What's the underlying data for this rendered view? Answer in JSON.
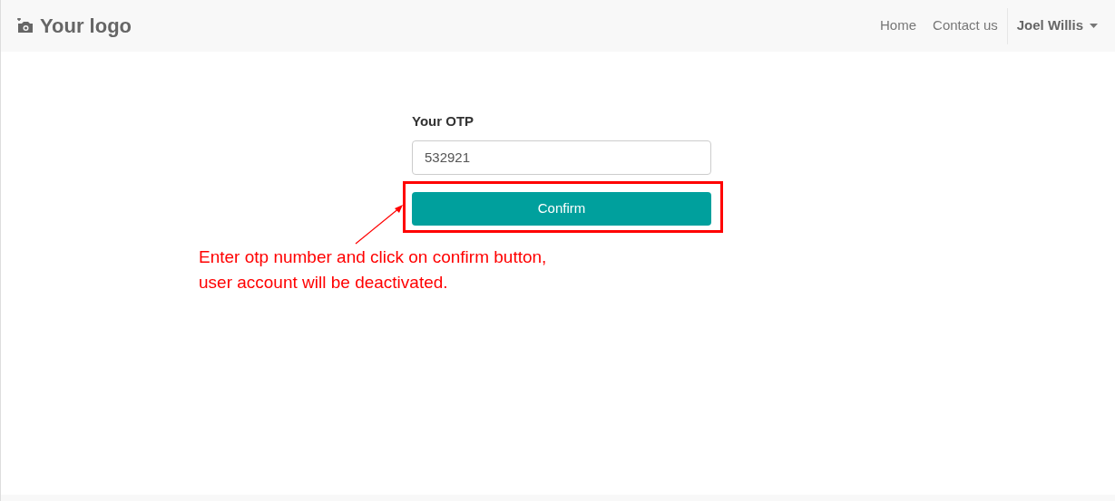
{
  "navbar": {
    "logo": "Your logo",
    "links": [
      "Home",
      "Contact us"
    ],
    "user": {
      "name": "Joel Willis"
    }
  },
  "form": {
    "label": "Your OTP",
    "value": "532921",
    "button": "Confirm"
  },
  "annotation": {
    "lines": [
      "Enter otp number and click on confirm button,",
      "user account will be deactivated."
    ]
  }
}
